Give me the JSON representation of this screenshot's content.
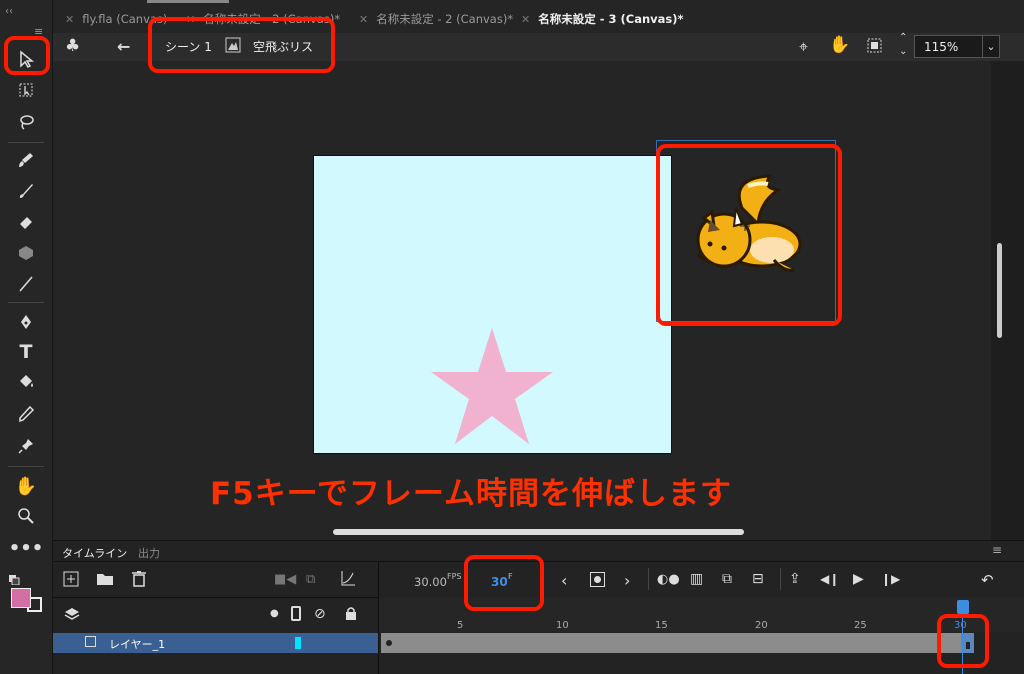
{
  "tabs": [
    {
      "label": "fly.fla (Canvas)",
      "active": false
    },
    {
      "label": "名称未設定 - 2 (Canvas)*",
      "active": false
    },
    {
      "label": "名称未設定 - 2 (Canvas)*",
      "active": false
    },
    {
      "label": "名称未設定 - 3 (Canvas)*",
      "active": true
    }
  ],
  "editbar": {
    "scene": "シーン 1",
    "symbol": "空飛ぶリス",
    "zoom": "115%"
  },
  "caption": "F5キーでフレーム時間を伸ばします",
  "timeline": {
    "tab_timeline": "タイムライン",
    "tab_output": "出力",
    "fps_value": "30.00",
    "fps_unit": "FPS",
    "current_frame": "30",
    "frame_unit": "F",
    "ruler": [
      "5",
      "10",
      "15",
      "20",
      "25",
      "30"
    ],
    "layer_name": "レイヤー_1"
  },
  "colors": {
    "highlight": "#ff1a00",
    "stage": "#d2f9fd",
    "star": "#f0b2cf",
    "fill_swatch": "#d46fa4",
    "layer_selected": "#3a5f93",
    "playhead": "#3a8de0"
  }
}
